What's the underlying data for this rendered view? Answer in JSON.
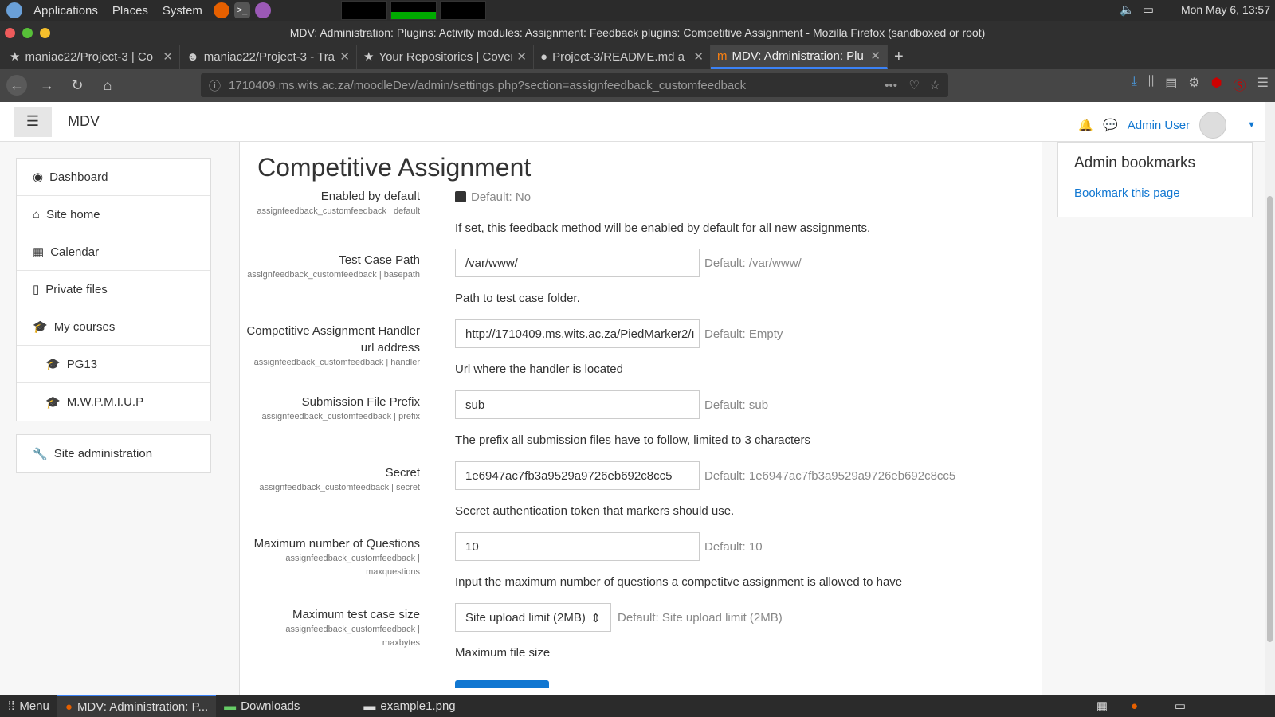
{
  "system": {
    "menu": [
      "Applications",
      "Places",
      "System"
    ],
    "clock": "Mon May  6, 13:57"
  },
  "window": {
    "title": "MDV: Administration: Plugins: Activity modules: Assignment: Feedback plugins: Competitive Assignment - Mozilla Firefox (sandboxed or root)"
  },
  "tabs": [
    {
      "label": "maniac22/Project-3 | Co"
    },
    {
      "label": "maniac22/Project-3 - Tra"
    },
    {
      "label": "Your Repositories | Cover"
    },
    {
      "label": "Project-3/README.md a"
    },
    {
      "label": "MDV: Administration: Plu"
    }
  ],
  "url": "1710409.ms.wits.ac.za/moodleDev/admin/settings.php?section=assignfeedback_customfeedback",
  "moodle": {
    "brand": "MDV",
    "user": "Admin User"
  },
  "sidebar": {
    "items": [
      "Dashboard",
      "Site home",
      "Calendar",
      "Private files",
      "My courses",
      "PG13",
      "M.W.P.M.I.U.P"
    ],
    "admin": "Site administration"
  },
  "page": {
    "title": "Competitive Assignment",
    "settings": [
      {
        "name": "Enabled by default",
        "key": "assignfeedback_customfeedback | default",
        "default": "Default: No",
        "desc": "If set, this feedback method will be enabled by default for all new assignments."
      },
      {
        "name": "Test Case Path",
        "key": "assignfeedback_customfeedback | basepath",
        "value": "/var/www/",
        "default": "Default: /var/www/",
        "desc": "Path to test case folder."
      },
      {
        "name": "Competitive Assignment Handler url address",
        "key": "assignfeedback_customfeedback | handler",
        "value": "http://1710409.ms.wits.ac.za/PiedMarker2/ı",
        "default": "Default: Empty",
        "desc": "Url where the handler is located"
      },
      {
        "name": "Submission File Prefix",
        "key": "assignfeedback_customfeedback | prefix",
        "value": "sub",
        "default": "Default: sub",
        "desc": "The prefix all submission files have to follow, limited to 3 characters"
      },
      {
        "name": "Secret",
        "key": "assignfeedback_customfeedback | secret",
        "value": "1e6947ac7fb3a9529a9726eb692c8cc5",
        "default": "Default: 1e6947ac7fb3a9529a9726eb692c8cc5",
        "desc": "Secret authentication token that markers should use."
      },
      {
        "name": "Maximum number of Questions",
        "key": "assignfeedback_customfeedback | maxquestions",
        "value": "10",
        "default": "Default: 10",
        "desc": "Input the maximum number of questions a competitve assignment is allowed to have"
      },
      {
        "name": "Maximum test case size",
        "key": "assignfeedback_customfeedback | maxbytes",
        "value": "Site upload limit (2MB)",
        "default": "Default: Site upload limit (2MB)",
        "desc": "Maximum file size"
      }
    ]
  },
  "block": {
    "title": "Admin bookmarks",
    "link": "Bookmark this page"
  },
  "taskbar": {
    "menu": "Menu",
    "items": [
      "MDV: Administration: P...",
      "Downloads",
      "example1.png"
    ]
  }
}
